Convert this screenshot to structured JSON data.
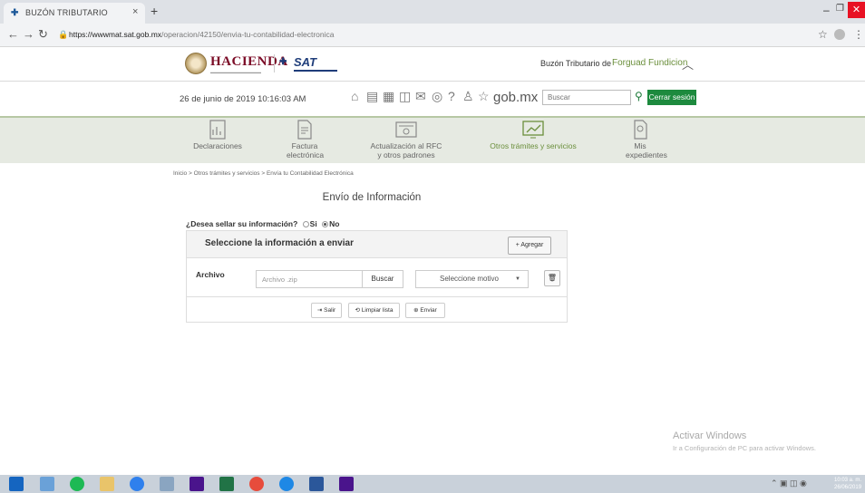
{
  "browser": {
    "tab_title": "BUZÓN TRIBUTARIO",
    "tab_close": "×",
    "new_tab": "+",
    "url_host": "https://wwwmat.sat.gob.mx",
    "url_path": "/operacion/42150/envia-tu-contabilidad-electronica"
  },
  "header": {
    "hacienda": "HACIENDA",
    "sat": "SAT",
    "buzon_label": "Buzón Tributario de",
    "buzon_user": "Forguad Fundicion",
    "date": "26 de junio de 2019 10:16:03 AM",
    "gobmx": "gob.mx",
    "search_placeholder": "Buscar",
    "logout": "Cerrar sesión"
  },
  "menu": [
    {
      "label": "Declaraciones",
      "icon": "chart-document-icon"
    },
    {
      "label": "Factura electrónica",
      "icon": "invoice-icon"
    },
    {
      "label": "Actualización al RFC y otros padrones",
      "icon": "id-card-icon"
    },
    {
      "label": "Otros trámites y servicios",
      "icon": "monitor-chart-icon",
      "active": true
    },
    {
      "label": "Mis expedientes",
      "icon": "file-icon"
    }
  ],
  "content": {
    "breadcrumb": "Inicio > Otros trámites y servicios > Envía tu Contabilidad Electrónica",
    "title": "Envío de Información",
    "seal_question": "¿Desea sellar su información?",
    "opt_si": "Si",
    "opt_no": "No",
    "panel_title": "Seleccione la información a enviar",
    "add_button": "+ Agregar",
    "file_label": "Archivo",
    "file_placeholder": "Archivo .zip",
    "browse_button": "Buscar",
    "reason_select": "Seleccione motivo",
    "exit_button": "Salir",
    "clear_button": "Limpiar lista",
    "send_button": "Enviar"
  },
  "watermark": {
    "line1": "Activar Windows",
    "line2": "Ir a Configuración de PC para activar Windows."
  },
  "taskbar": {
    "clock_time": "10:03 a. m.",
    "clock_date": "26/06/2019"
  },
  "colors": {
    "accent_green": "#1d8a3e",
    "menu_active": "#6b8f3c",
    "hacienda_maroon": "#7b0b26",
    "sat_blue": "#1f3d7a"
  }
}
